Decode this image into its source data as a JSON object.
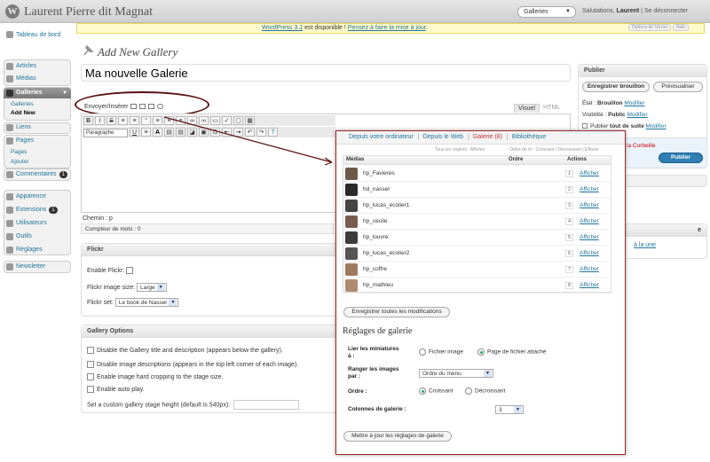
{
  "header": {
    "site_title": "Laurent Pierre dit Magnat",
    "favorites_select": "Galleries",
    "howdy_prefix": "Salutations,",
    "howdy_user": "Laurent",
    "howdy_sep": "|",
    "logout": "Se déconnecter"
  },
  "nag": {
    "link1": "WordPress 3.1",
    "text": " est disponible ! ",
    "link2": "Pensez à faire la mise à jour",
    "end": ".",
    "btn_options": "Options de l'écran",
    "btn_help": "Aide"
  },
  "menu": {
    "dashboard": "Tableau de bord",
    "posts": "Articles",
    "media": "Médias",
    "galleries": "Galleries",
    "gal_sub1": "Galleries",
    "gal_sub2": "Add New",
    "links": "Liens",
    "pages": "Pages",
    "pages_sub1": "Pages",
    "pages_sub2": "Ajouter",
    "comments": "Commentaires",
    "comments_count": "1",
    "appearance": "Apparence",
    "extensions": "Extensions",
    "extensions_count": "1",
    "users": "Utilisateurs",
    "tools": "Outils",
    "settings": "Réglages",
    "newsletter": "Newsletter"
  },
  "page": {
    "title": "Add New Gallery",
    "post_title": "Ma nouvelle Galerie",
    "upload_label": "Envoyer/Insérer",
    "tab_visual": "Visuel",
    "tab_html": "HTML",
    "format_select": "Paragraphe",
    "path": "Chemin : p",
    "word_count": "Compteur de mots : 0"
  },
  "flickr": {
    "title": "Flickr",
    "enable_label": "Enable Flickr:",
    "size_label": "Flickr image size:",
    "size_value": "Large",
    "set_label": "Flickr set:",
    "set_value": "Le book de Nasser"
  },
  "gallery_options": {
    "title": "Gallery Options",
    "opt1": "Disable the Gallery title and description (appears below the gallery).",
    "opt2": "Disable image descriptions (appears in the top left corner of each image).",
    "opt3": "Enable image hard cropping to the stage size.",
    "opt4": "Enable auto play.",
    "stage_label": "Set a custom gallery stage height (default is 540px):"
  },
  "publish": {
    "title": "Publier",
    "save_draft": "Enregistrer brouillon",
    "preview": "Prévisualiser",
    "status_label": "État :",
    "status_value": "Brouillon",
    "visibility_label": "Visibilité :",
    "visibility_value": "Public",
    "publish_label": "Publier",
    "publish_value": "tout de suite",
    "edit": "Modifier",
    "trash": "la Corbeille",
    "publish_btn": "Publier",
    "side_text1": "e",
    "side_link": "à la une"
  },
  "popup": {
    "tabs": [
      "Depuis votre ordinateur",
      "Depuis le Web",
      "Galerie (8)",
      "Bibliothèque"
    ],
    "sort_left": "Tous les onglets : Afficher",
    "sort_right": "Ordre de tri : Croissant | Décroissant | Effacer",
    "col_media": "Médias",
    "col_order": "Ordre",
    "col_actions": "Actions",
    "items": [
      {
        "name": "hp_Favieres",
        "order": "1",
        "action": "Afficher"
      },
      {
        "name": "hd_nasser",
        "order": "2",
        "action": "Afficher"
      },
      {
        "name": "hp_lucas_ecolier1",
        "order": "3",
        "action": "Afficher"
      },
      {
        "name": "hp_cecile",
        "order": "4",
        "action": "Afficher"
      },
      {
        "name": "hp_louvre",
        "order": "5",
        "action": "Afficher"
      },
      {
        "name": "hp_lucas_ecolier2",
        "order": "6",
        "action": "Afficher"
      },
      {
        "name": "hp_coffre",
        "order": "7",
        "action": "Afficher"
      },
      {
        "name": "hp_mathieu",
        "order": "8",
        "action": "Afficher"
      }
    ],
    "save_all": "Enregistrer toutes les modifications",
    "settings_title": "Réglages de galerie",
    "link_label1": "Lier les miniatures",
    "link_label2": "à :",
    "link_opt1": "Fichier image",
    "link_opt2": "Page de fichier attaché",
    "sort_label1": "Ranger les images",
    "sort_label2": "par :",
    "sort_value": "Ordre du menu",
    "order_label": "Ordre :",
    "order_opt1": "Croissant",
    "order_opt2": "Décroissant",
    "cols_label": "Colonnes de galerie :",
    "cols_value": "3",
    "update_btn": "Mettre à jour les réglages de galerie"
  },
  "colors": {
    "accent": "#21759b",
    "annotation": "#5a1010",
    "publish": "#2e7fb3"
  }
}
